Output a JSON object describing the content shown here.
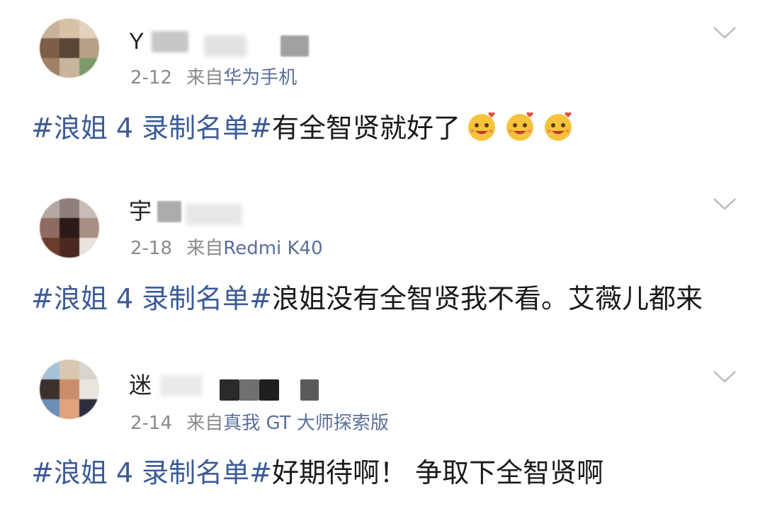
{
  "posts": [
    {
      "username": "Y",
      "date": "2-12",
      "from_prefix": "来自",
      "source": "华为手机",
      "topic": "#浪姐 4 录制名单#",
      "text": "有全智贤就好了",
      "emojis": [
        "smiling-face-with-hearts",
        "smiling-face-with-hearts",
        "smiling-face-with-hearts"
      ]
    },
    {
      "username": "宇",
      "date": "2-18",
      "from_prefix": "来自",
      "source": "Redmi K40",
      "topic": "#浪姐 4 录制名单#",
      "text": "浪姐没有全智贤我不看。艾薇儿都来",
      "emojis": []
    },
    {
      "username": "迷",
      "date": "2-14",
      "from_prefix": "来自",
      "source": "真我 GT 大师探索版",
      "topic": "#浪姐 4 录制名单#",
      "text": "好期待啊！ 争取下全智贤啊",
      "emojis": []
    }
  ],
  "icons": {
    "expand": "chevron-down-icon",
    "emoji": "smiling-face-with-hearts"
  },
  "colors": {
    "topic": "#3c5b97",
    "source": "#5b6f99",
    "meta": "#8a8a8a"
  }
}
